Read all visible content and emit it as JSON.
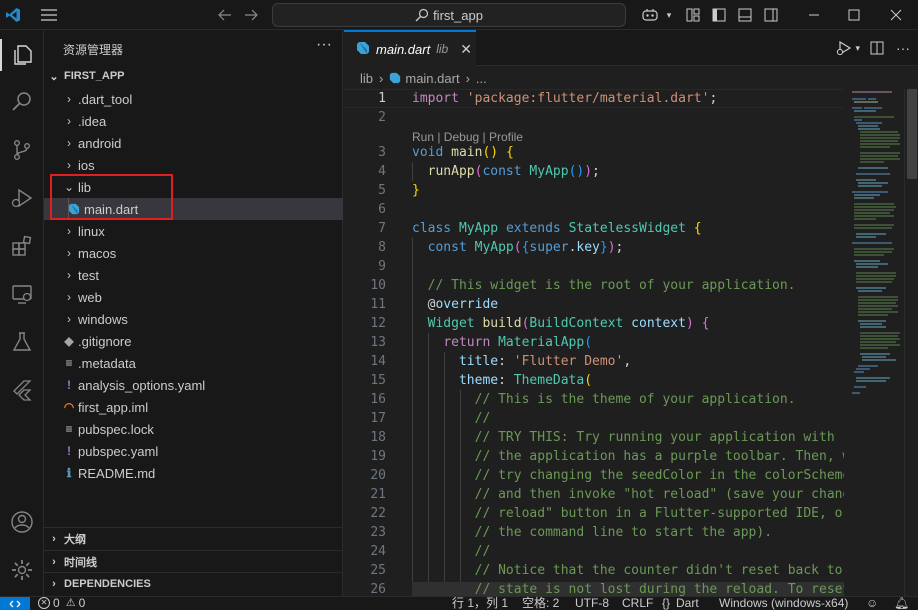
{
  "window": {
    "search_text": "first_app"
  },
  "sidebar": {
    "title": "资源管理器",
    "more": "···",
    "root": "FIRST_APP",
    "items": [
      {
        "name": ".dart_tool",
        "type": "folder"
      },
      {
        "name": ".idea",
        "type": "folder"
      },
      {
        "name": "android",
        "type": "folder"
      },
      {
        "name": "ios",
        "type": "folder"
      },
      {
        "name": "lib",
        "type": "folder-open"
      },
      {
        "name": "main.dart",
        "type": "dart-file"
      },
      {
        "name": "linux",
        "type": "folder"
      },
      {
        "name": "macos",
        "type": "folder"
      },
      {
        "name": "test",
        "type": "folder"
      },
      {
        "name": "web",
        "type": "folder"
      },
      {
        "name": "windows",
        "type": "folder"
      },
      {
        "name": ".gitignore",
        "type": "git-file"
      },
      {
        "name": ".metadata",
        "type": "text-file"
      },
      {
        "name": "analysis_options.yaml",
        "type": "yaml-file"
      },
      {
        "name": "first_app.iml",
        "type": "rss-file"
      },
      {
        "name": "pubspec.lock",
        "type": "text-file"
      },
      {
        "name": "pubspec.yaml",
        "type": "yaml-file"
      },
      {
        "name": "README.md",
        "type": "info-file"
      }
    ],
    "sections": [
      "大纲",
      "时间线",
      "DEPENDENCIES"
    ]
  },
  "editor": {
    "tab": {
      "name": "main.dart",
      "desc": "lib",
      "close": "✕"
    },
    "breadcrumb": [
      "lib",
      "main.dart",
      "..."
    ],
    "codelens": "Run | Debug | Profile",
    "line_numbers": [
      "1",
      "2",
      "3",
      "4",
      "5",
      "6",
      "7",
      "8",
      "9",
      "10",
      "11",
      "12",
      "13",
      "14",
      "15",
      "16",
      "17",
      "18",
      "19",
      "20",
      "21",
      "22",
      "23",
      "24",
      "25",
      "26"
    ]
  },
  "statusbar": {
    "errors": "0",
    "warnings": "0",
    "position": "行 1，列 1",
    "spaces": "空格: 2",
    "encoding": "UTF-8",
    "eol": "CRLF",
    "language": "Dart",
    "device": "Windows (windows-x64)"
  },
  "colors": {
    "accent": "#0078d4",
    "highlight_box": "#e02020"
  }
}
